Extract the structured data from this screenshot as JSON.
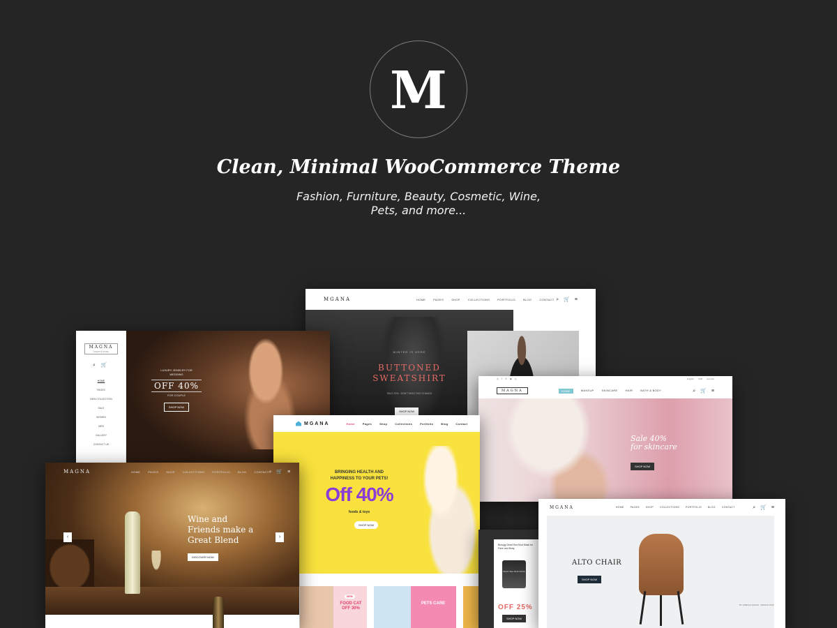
{
  "hero": {
    "logo_letter": "M",
    "headline": "Clean, Minimal WooCommerce Theme",
    "subline_1": "Fashion, Furniture, Beauty, Cosmetic, Wine,",
    "subline_2": "Pets, and more..."
  },
  "fashion": {
    "brand": "MGANA",
    "nav": [
      "HOME",
      "PAGES",
      "SHOP",
      "COLLECTIONS",
      "PORTFOLIO",
      "BLOG",
      "CONTACT"
    ],
    "tagline": "WINTER IS HERE",
    "title_1": "BUTTONED",
    "title_2": "SWEATSHIRT",
    "small": "SALE 30% · DON'T MISS THIS CHANCE",
    "button": "SHOP NOW"
  },
  "jewelry": {
    "brand": "MAGNA",
    "brand_tag": "CREATIVE STORE",
    "menu": [
      "HOME",
      "PAGES",
      "NEW COLLECTION",
      "SALE",
      "WOMEN",
      "MEN",
      "GALLERY",
      "CONTACT US"
    ],
    "line_1": "LUXURY JEWELRY FOR",
    "line_2": "WEDDING",
    "offer": "OFF 40%",
    "line_3": "FOR COUPLE",
    "button": "SHOP NOW"
  },
  "beauty": {
    "brand": "MAGNA",
    "social": [
      "◎",
      "f",
      "✕",
      "◆",
      "◎"
    ],
    "top_right": [
      "English",
      "USD",
      "Account"
    ],
    "nav": [
      "HOME",
      "MAKEUP",
      "SKINCARE",
      "HAIR",
      "BATH & BODY"
    ],
    "sale_1": "Sale 40%",
    "sale_2": "for skincare",
    "button": "SHOP NOW"
  },
  "pets": {
    "brand": "MGANA",
    "nav": [
      "Home",
      "Pages",
      "Shop",
      "Collections",
      "Portfolio",
      "Blog",
      "Contact"
    ],
    "headline_1": "BRINGING HEALTH AND",
    "headline_2": "HAPPINESS TO YOUR PETS!",
    "offer": "Off 40%",
    "foods": "foods & toys",
    "button": "SHOP NOW",
    "tile_new": "NEW!",
    "tile_cat_1": "FOOD CAT",
    "tile_cat_2": "OFF 30%",
    "tile_care": "PETS CARE"
  },
  "wine": {
    "brand": "MAGNA",
    "nav": [
      "HOME",
      "PAGES",
      "SHOP",
      "COLLECTIONS",
      "PORTFOLIO",
      "BLOG",
      "CONTACT"
    ],
    "title_1": "Wine and",
    "title_2": "Friends make a",
    "title_3": "Great Blend",
    "button": "DISCOVER NOW",
    "prev": "‹",
    "next": "›"
  },
  "product": {
    "title": "Biology Dead Sea Mud Mask for Face and Body",
    "jar_label": "DEAD SEA MUD MASK",
    "offer": "OFF 25%",
    "button": "SHOP NOW"
  },
  "chair": {
    "brand": "MGANA",
    "nav": [
      "HOME",
      "PAGES",
      "SHOP",
      "COLLECTIONS",
      "PORTFOLIO",
      "BLOG",
      "CONTACT"
    ],
    "title": "ALTO CHAIR",
    "button": "SHOP NOW",
    "footnote": "BY FABIOLA MAGNI · DESIGN 2018"
  },
  "icons": {
    "search": "⌕",
    "cart": "🛒",
    "menu": "≡"
  }
}
